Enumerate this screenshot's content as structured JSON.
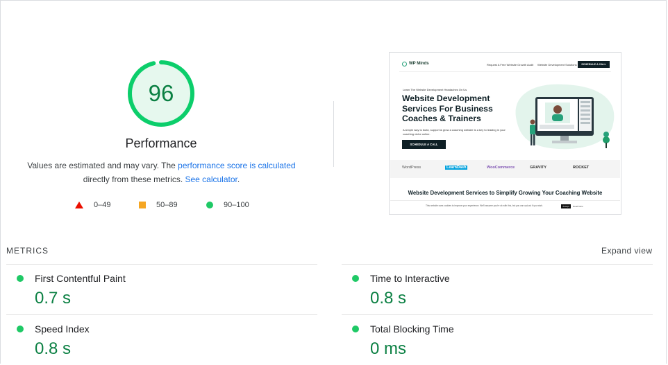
{
  "score": {
    "value": "96",
    "fraction": 0.96,
    "category": "Performance",
    "color": "#0cce6b"
  },
  "description": {
    "prefix": "Values are estimated and may vary. The ",
    "link1": "performance score is calculated",
    "middle": " directly from these metrics. ",
    "link2": "See calculator",
    "suffix": "."
  },
  "legend": [
    {
      "range": "0–49",
      "icon": "red-triangle-icon",
      "color": "#eb0f00"
    },
    {
      "range": "50–89",
      "icon": "orange-square-icon",
      "color": "#f5a623"
    },
    {
      "range": "90–100",
      "icon": "green-circle-icon",
      "color": "#1fc966"
    }
  ],
  "screenshot": {
    "logo": "WP Minds",
    "nav": [
      "Request A Free Website Growth Audit",
      "Website Development Solutions"
    ],
    "cta": "SCHEDULE A CALL",
    "eyebrow": "Learn The Website Development Headaches On Us",
    "headline": "Website Development Services For Business Coaches & Trainers",
    "sub": "A simple way to build, support & grow a coaching website is a key to leading in your coaching niche online.",
    "button": "SCHEDULE A CALL",
    "brands": [
      "WordPress",
      "LearnDash",
      "WooCommerce",
      "GRAVITY",
      "ROCKET"
    ],
    "section_title": "Website Development Services to Simplify Growing Your Coaching Website",
    "cookie": "This website uses cookies to improve your experience. We'll assume you're ok with this, but you can opt-out if you wish.",
    "accept": "Accept",
    "read_more": "Read More"
  },
  "metrics": {
    "title": "METRICS",
    "expand": "Expand view",
    "items": [
      {
        "label": "First Contentful Paint",
        "value": "0.7 s"
      },
      {
        "label": "Time to Interactive",
        "value": "0.8 s"
      },
      {
        "label": "Speed Index",
        "value": "0.8 s"
      },
      {
        "label": "Total Blocking Time",
        "value": "0 ms"
      }
    ]
  }
}
